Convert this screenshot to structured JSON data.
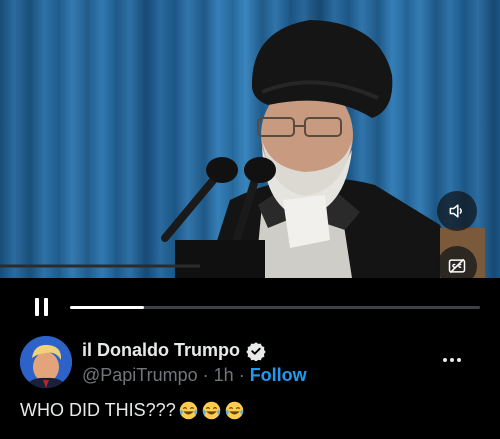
{
  "video": {
    "sound_icon": "speaker-icon",
    "caption_icon": "captions-icon",
    "playback_progress": 0.18
  },
  "controls": {
    "pause_icon": "pause-icon"
  },
  "post": {
    "display_name": "il Donaldo Trumpo",
    "verified_icon": "verified-badge-icon",
    "handle": "@PapiTrumpo",
    "separator": "·",
    "time": "1h",
    "separator2": "·",
    "follow_label": "Follow",
    "more_icon": "more-icon",
    "text": "WHO DID THIS???",
    "emojis": [
      "face-with-tears-of-joy-icon",
      "face-with-tears-of-joy-icon",
      "face-with-tears-of-joy-icon"
    ]
  },
  "colors": {
    "accent": "#1d9bf0",
    "background": "#000000",
    "secondary_text": "#71767b"
  }
}
